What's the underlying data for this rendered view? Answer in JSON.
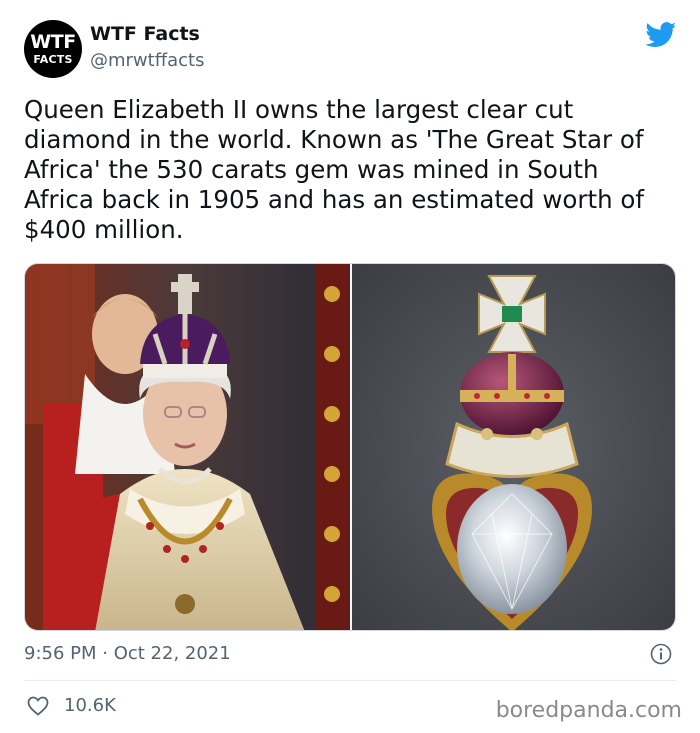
{
  "author": {
    "avatar_line1": "WTF",
    "avatar_line2": "FACTS",
    "name": "WTF Facts",
    "handle": "@mrwtffacts"
  },
  "tweet": {
    "text": "Queen Elizabeth II owns the largest clear cut\ndiamond in the world. Known as 'The Great Star of\nAfrica' the 530 carats gem was mined in South\nAfrica back in 1905 and has an estimated worth of\n$400 million.",
    "timestamp": "9:56 PM · Oct 22, 2021",
    "likes": "10.6K"
  },
  "media": {
    "left_photo": "queen-wearing-crown",
    "right_photo": "great-star-of-africa-scepter"
  },
  "watermark": "boredpanda.com",
  "colors": {
    "twitter_blue": "#1d9bf0",
    "secondary_text": "#536471"
  },
  "icons": [
    "twitter-bird-icon",
    "info-icon",
    "heart-icon"
  ]
}
